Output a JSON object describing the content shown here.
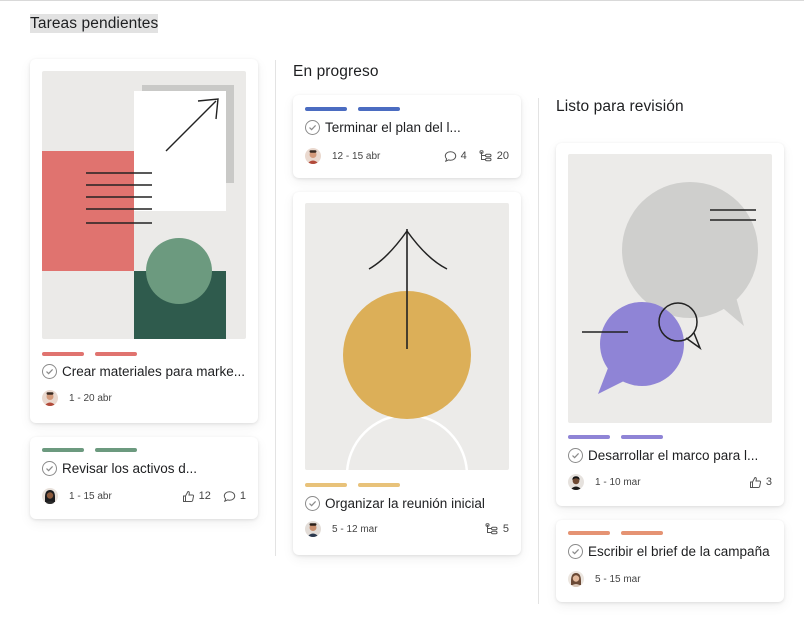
{
  "columns": [
    {
      "title": "Tareas pendientes",
      "cards": [
        {
          "tag_colors": [
            "#e0736f",
            "#e0736f"
          ],
          "task": "Crear materiales para marke...",
          "avatar": "man-avatar",
          "date": "1 - 20 abr"
        },
        {
          "tag_colors": [
            "#6c9a7f",
            "#6c9a7f"
          ],
          "task": "Revisar los activos d...",
          "avatar": "woman-avatar",
          "date": "1 - 15 abr",
          "likes": "12",
          "comments": "1"
        }
      ]
    },
    {
      "title": "En progreso",
      "cards": [
        {
          "tag_colors": [
            "#4b6cc1",
            "#4b6cc1"
          ],
          "task": "Terminar el plan del l...",
          "avatar": "man-avatar",
          "date": "12 - 15 abr",
          "comments": "4",
          "subtasks": "20"
        },
        {
          "tag_colors": [
            "#e8c27a",
            "#e8c27a"
          ],
          "task": "Organizar la reunión inicial",
          "avatar": "man-avatar",
          "date": "5 - 12 mar",
          "subtasks": "5"
        }
      ]
    },
    {
      "title": "Listo para revisión",
      "cards": [
        {
          "tag_colors": [
            "#8f84d6",
            "#8f84d6"
          ],
          "task": "Desarrollar el marco para l...",
          "avatar": "man-avatar-dark",
          "date": "1 - 10 mar",
          "likes": "3"
        },
        {
          "tag_colors": [
            "#e59373",
            "#e59373"
          ],
          "task": "Escribir el brief de la campaña",
          "avatar": "woman-avatar-light",
          "date": "5 - 15 mar"
        }
      ]
    }
  ]
}
